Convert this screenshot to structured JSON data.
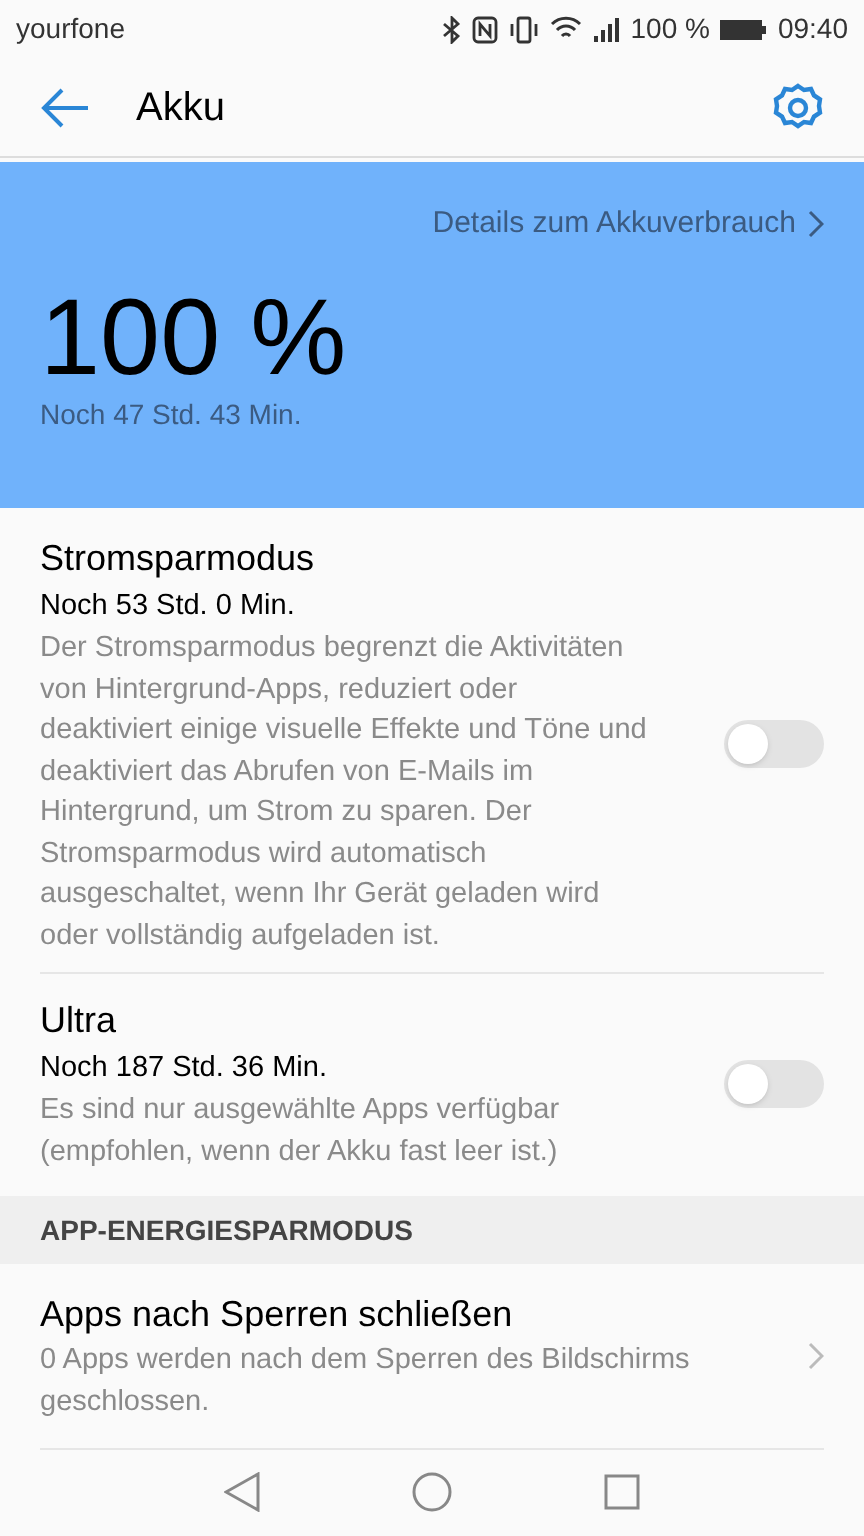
{
  "status_bar": {
    "carrier": "yourfone",
    "battery_text": "100 %",
    "time": "09:40"
  },
  "header": {
    "title": "Akku"
  },
  "battery": {
    "details_link": "Details zum Akkuverbrauch",
    "percent": "100 %",
    "remaining": "Noch 47 Std. 43 Min."
  },
  "modes": [
    {
      "title": "Stromsparmodus",
      "remaining": "Noch 53 Std. 0 Min.",
      "description": "Der Stromsparmodus begrenzt die Aktivitäten von Hintergrund-Apps, reduziert oder deaktiviert einige visuelle Effekte und Töne und deaktiviert das Abrufen von E-Mails im Hintergrund, um Strom zu sparen. Der Stromsparmodus wird automatisch ausgeschaltet, wenn Ihr Gerät geladen wird oder vollständig aufgeladen ist.",
      "on": false
    },
    {
      "title": "Ultra",
      "remaining": "Noch 187 Std. 36 Min.",
      "description": "Es sind nur ausgewählte Apps verfügbar (empfohlen, wenn der Akku fast leer ist.)",
      "on": false
    }
  ],
  "section": {
    "heading": "APP-ENERGIESPARMODUS",
    "items": [
      {
        "title": "Apps nach Sperren schließen",
        "description": "0 Apps werden nach dem Sperren des Bildschirms geschlossen."
      }
    ]
  }
}
